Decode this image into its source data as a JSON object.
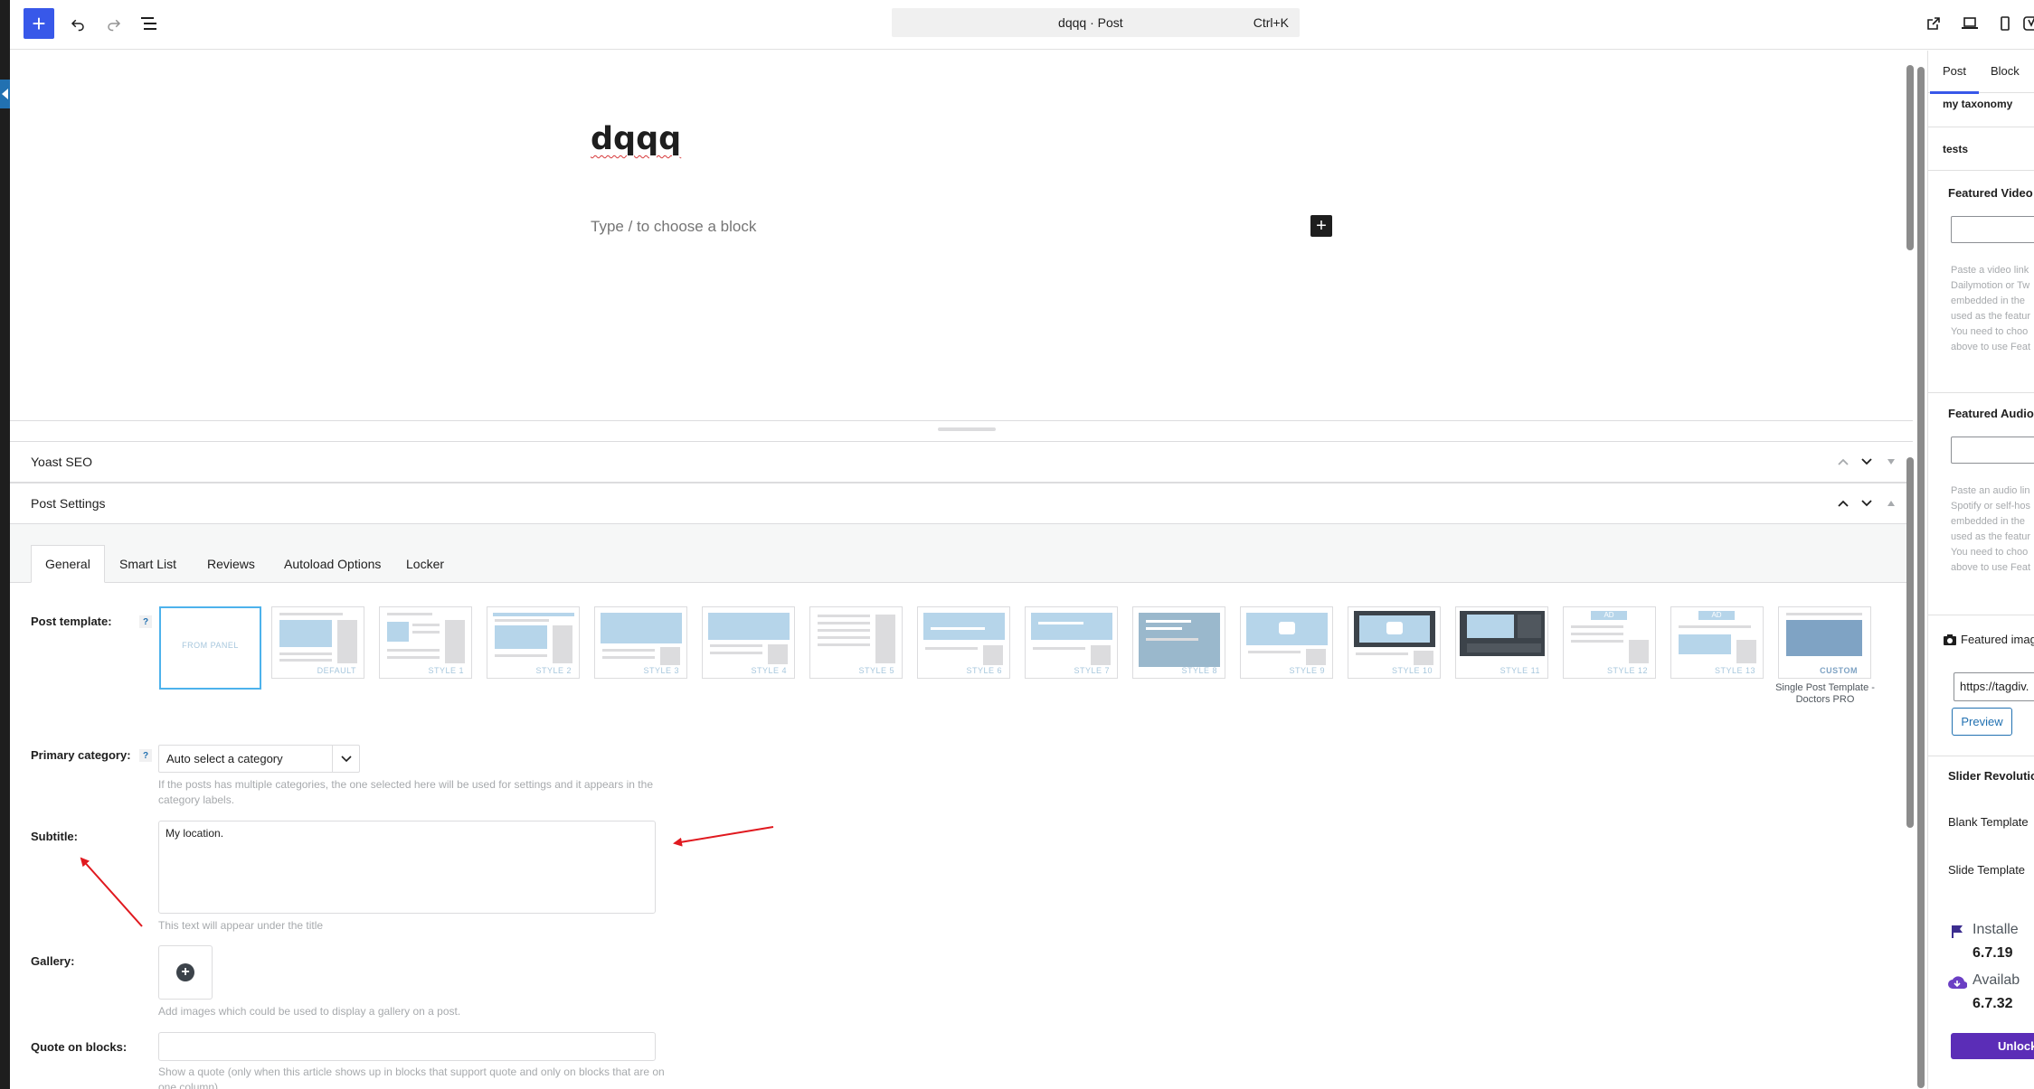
{
  "topbar": {
    "document_title": "dqqq · Post",
    "shortcut": "Ctrl+K"
  },
  "canvas": {
    "post_title": "dqqq",
    "block_placeholder": "Type / to choose a block"
  },
  "metaboxes": {
    "yoast_title": "Yoast SEO",
    "post_settings_title": "Post Settings"
  },
  "post_settings": {
    "tabs": [
      "General",
      "Smart List",
      "Reviews",
      "Autoload Options",
      "Locker"
    ],
    "post_template_label": "Post template:",
    "help_mark": "?",
    "templates": [
      "FROM PANEL",
      "DEFAULT",
      "STYLE 1",
      "STYLE 2",
      "STYLE 3",
      "STYLE 4",
      "STYLE 5",
      "STYLE 6",
      "STYLE 7",
      "STYLE 8",
      "STYLE 9",
      "STYLE 10",
      "STYLE 11",
      "STYLE 12",
      "STYLE 13",
      "CUSTOM"
    ],
    "ad_label": "AD",
    "custom_caption": "Single Post Template - Doctors PRO",
    "primary_category_label": "Primary category:",
    "primary_category_value": "Auto select a category",
    "primary_category_help": "If the posts has multiple categories, the one selected here will be used for settings and it appears in the category labels.",
    "subtitle_label": "Subtitle:",
    "subtitle_value": "My location.",
    "subtitle_help": "This text will appear under the title",
    "gallery_label": "Gallery:",
    "gallery_help": "Add images which could be used to display a gallery on a post.",
    "quote_label": "Quote on blocks:",
    "quote_help": "Show a quote (only when this article shows up in blocks that support quote and only on blocks that are on one column)"
  },
  "sidebar": {
    "tab_post": "Post",
    "tab_block": "Block",
    "my_taxonomy": "my taxonomy",
    "tests": "tests",
    "featured_video_title": "Featured Video",
    "featured_video_help": [
      "Paste a video link",
      "Dailymotion or Tw",
      "embedded in the",
      "used as the featur",
      "You need to choo",
      "above to use Feat"
    ],
    "featured_audio_title": "Featured Audio",
    "featured_audio_help": [
      "Paste an audio lin",
      "Spotify or self-hos",
      "embedded in the",
      "used as the featur",
      "You need to choo",
      "above to use Feat"
    ],
    "featured_image_title": "Featured imag",
    "featured_image_url": "https://tagdiv.",
    "preview_button": "Preview",
    "slider_title": "Slider Revolutio",
    "blank_template": "Blank Template",
    "slide_template": "Slide Template",
    "installed_label": "Installe",
    "installed_version": "6.7.19",
    "available_label": "Availab",
    "available_version": "6.7.32",
    "unlock_button": "Unlock"
  },
  "colors": {
    "accent": "#3858e9",
    "annotation_arrow": "#e0191f",
    "template_highlight": "#4db2ec",
    "unlock_purple": "#5b2db7"
  }
}
